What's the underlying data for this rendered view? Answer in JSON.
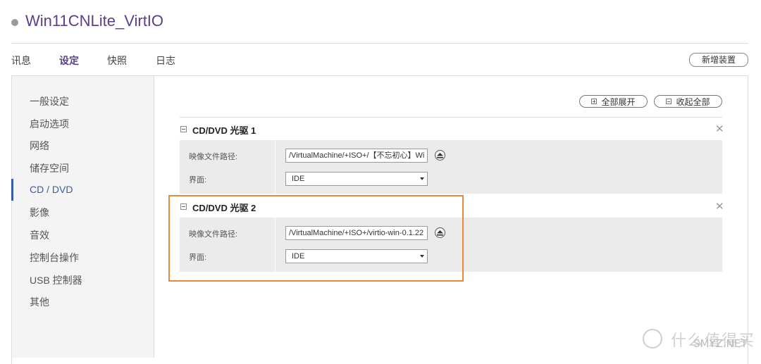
{
  "header": {
    "title": "Win11CNLite_VirtIO"
  },
  "tabs": [
    {
      "label": "讯息",
      "active": false
    },
    {
      "label": "设定",
      "active": true
    },
    {
      "label": "快照",
      "active": false
    },
    {
      "label": "日志",
      "active": false
    }
  ],
  "toolbar": {
    "add_device_label": "新增装置"
  },
  "sidebar": {
    "items": [
      {
        "label": "一般设定"
      },
      {
        "label": "启动选项"
      },
      {
        "label": "网络"
      },
      {
        "label": "储存空间"
      },
      {
        "label": "CD / DVD",
        "active": true
      },
      {
        "label": "影像"
      },
      {
        "label": "音效"
      },
      {
        "label": "控制台操作"
      },
      {
        "label": "USB 控制器"
      },
      {
        "label": "其他"
      }
    ]
  },
  "actions": {
    "expand_all": "全部展开",
    "collapse_all": "收起全部"
  },
  "drives": [
    {
      "title": "CD/DVD 光驱 1",
      "path_label": "映像文件路径:",
      "path_value": "/VirtualMachine/+ISO+/【不忘初心】Wi",
      "interface_label": "界面:",
      "interface_value": "IDE"
    },
    {
      "title": "CD/DVD 光驱 2",
      "path_label": "映像文件路径:",
      "path_value": "/VirtualMachine/+ISO+/virtio-win-0.1.22",
      "interface_label": "界面:",
      "interface_value": "IDE"
    }
  ],
  "colors": {
    "accent": "#5a3e8a",
    "active_nav": "#3b5aa6",
    "highlight": "#e88a3a"
  },
  "icons": {
    "close": "close-icon",
    "eject": "eject-icon",
    "collapse": "collapse-icon",
    "expand": "expand-icon"
  },
  "watermark": {
    "text": "什么值得买",
    "site": "SMYZ.NET"
  }
}
